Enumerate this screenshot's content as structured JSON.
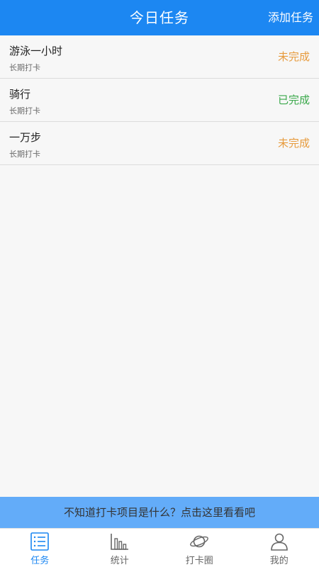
{
  "header": {
    "title": "今日任务",
    "action_label": "添加任务"
  },
  "tasks": [
    {
      "name": "游泳一小时",
      "subtitle": "长期打卡",
      "status": "未完成",
      "status_color": "#e79b3d"
    },
    {
      "name": "骑行",
      "subtitle": "长期打卡",
      "status": "已完成",
      "status_color": "#3aa84a"
    },
    {
      "name": "一万步",
      "subtitle": "长期打卡",
      "status": "未完成",
      "status_color": "#e79b3d"
    }
  ],
  "tip_banner": {
    "text": "不知道打卡项目是什么？点击这里看看吧"
  },
  "tabbar": {
    "tabs": [
      {
        "label": "任务",
        "icon": "task-list-icon",
        "active": true
      },
      {
        "label": "统计",
        "icon": "bar-chart-icon",
        "active": false
      },
      {
        "label": "打卡圈",
        "icon": "planet-icon",
        "active": false
      },
      {
        "label": "我的",
        "icon": "user-icon",
        "active": false
      }
    ],
    "active_color": "#1c87f2",
    "inactive_color": "#666666"
  }
}
